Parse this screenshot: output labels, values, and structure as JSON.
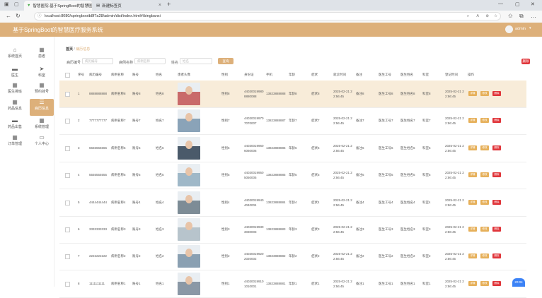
{
  "browser": {
    "tabs": [
      {
        "label": "智慧医院-基于SpringBoot的智慧医疗..."
      },
      {
        "label": "新建标签页"
      }
    ],
    "url": "localhost:8080/springbootb8f7a28/admin/dist/index.html#/bingbanxi"
  },
  "app": {
    "title": "基于SpringBoot的智慧医疗服务系统",
    "user": "admin"
  },
  "sidebar": {
    "items": [
      {
        "label": "系统首页",
        "icon": "home-icon"
      },
      {
        "label": "患者",
        "icon": "grid-icon"
      },
      {
        "label": "医生",
        "icon": "grid-icon"
      },
      {
        "label": "科室",
        "icon": "send-icon"
      },
      {
        "label": "医生排班",
        "icon": "grid-icon"
      },
      {
        "label": "预约挂号",
        "icon": "grid-icon"
      },
      {
        "label": "药品信息",
        "icon": "grid-icon"
      },
      {
        "label": "病历信息",
        "icon": "grid-icon"
      },
      {
        "label": "药品出售",
        "icon": "grid-icon"
      },
      {
        "label": "系统管理",
        "icon": "grid-icon"
      },
      {
        "label": "订单管理",
        "icon": "grid-icon"
      },
      {
        "label": "个人中心",
        "icon": "card-icon"
      }
    ]
  },
  "breadcrumb": {
    "home": "首页",
    "current": "病历信息"
  },
  "search": {
    "field1_label": "病历编号",
    "field1_placeholder": "病历编号",
    "field2_label": "病例名称",
    "field2_placeholder": "病例名称",
    "field3_label": "姓名",
    "field3_placeholder": "姓名",
    "search_btn": "查询",
    "delete_btn": "删除"
  },
  "table": {
    "headers": [
      "序号",
      "病历编号",
      "病例名称",
      "账号",
      "姓名",
      "患者头像",
      "性别",
      "身份证",
      "手机",
      "年龄",
      "症状",
      "就诊时间",
      "备注",
      "医生工号",
      "医生姓名",
      "科室",
      "登记时间",
      "操作"
    ],
    "rows": [
      {
        "idx": "1",
        "no": "8888888888",
        "name": "病例名称8",
        "acct": "账号8",
        "pname": "姓名8",
        "sex": "性别8",
        "id1": "44030019980",
        "id2": "8880088",
        "phone": "13823888888",
        "age": "年龄8",
        "sym": "症状8",
        "t1": "2025-02-21 2",
        "t2": "2:56:45",
        "note": "备注8",
        "dno": "医生工号8",
        "dname": "医生姓名8",
        "dept": "科室8",
        "r1": "2025-02-21 2",
        "r2": "2:56:45"
      },
      {
        "idx": "2",
        "no": "7777777777",
        "name": "病例名称7",
        "acct": "账号7",
        "pname": "姓名7",
        "sex": "性别7",
        "id1": "44030019970",
        "id2": "7070007",
        "phone": "13823888887",
        "age": "年龄7",
        "sym": "症状7",
        "t1": "2025-02-21 2",
        "t2": "2:56:45",
        "note": "备注7",
        "dno": "医生工号7",
        "dname": "医生姓名7",
        "dept": "科室7",
        "r1": "2025-02-21 2",
        "r2": "2:56:45"
      },
      {
        "idx": "3",
        "no": "6666666666",
        "name": "病例名称6",
        "acct": "账号6",
        "pname": "姓名6",
        "sex": "性别6",
        "id1": "44030019960",
        "id2": "6060006",
        "phone": "13823888886",
        "age": "年龄6",
        "sym": "症状6",
        "t1": "2025-02-21 2",
        "t2": "2:56:45",
        "note": "备注6",
        "dno": "医生工号6",
        "dname": "医生姓名6",
        "dept": "科室6",
        "r1": "2025-02-21 2",
        "r2": "2:56:45"
      },
      {
        "idx": "4",
        "no": "5555555555",
        "name": "病例名称5",
        "acct": "账号5",
        "pname": "姓名5",
        "sex": "性别5",
        "id1": "44030019950",
        "id2": "5050005",
        "phone": "13823888885",
        "age": "年龄5",
        "sym": "症状5",
        "t1": "2025-02-21 2",
        "t2": "2:56:45",
        "note": "备注5",
        "dno": "医生工号5",
        "dname": "医生姓名5",
        "dept": "科室5",
        "r1": "2025-02-21 2",
        "r2": "2:56:45"
      },
      {
        "idx": "5",
        "no": "4444444444",
        "name": "病例名称4",
        "acct": "账号4",
        "pname": "姓名4",
        "sex": "性别4",
        "id1": "44030019940",
        "id2": "4040004",
        "phone": "13823888884",
        "age": "年龄4",
        "sym": "症状4",
        "t1": "2025-02-21 2",
        "t2": "2:56:45",
        "note": "备注4",
        "dno": "医生工号4",
        "dname": "医生姓名4",
        "dept": "科室4",
        "r1": "2025-02-21 2",
        "r2": "2:56:45"
      },
      {
        "idx": "6",
        "no": "3333333333",
        "name": "病例名称3",
        "acct": "账号3",
        "pname": "姓名3",
        "sex": "性别3",
        "id1": "44030019930",
        "id2": "3030003",
        "phone": "13823888883",
        "age": "年龄3",
        "sym": "症状3",
        "t1": "2025-02-21 2",
        "t2": "2:56:45",
        "note": "备注3",
        "dno": "医生工号3",
        "dname": "医生姓名3",
        "dept": "科室3",
        "r1": "2025-02-21 2",
        "r2": "2:56:45"
      },
      {
        "idx": "7",
        "no": "2222222222",
        "name": "病例名称2",
        "acct": "账号2",
        "pname": "姓名2",
        "sex": "性别2",
        "id1": "44030019920",
        "id2": "2020002",
        "phone": "13823888882",
        "age": "年龄2",
        "sym": "症状2",
        "t1": "2025-02-21 2",
        "t2": "2:56:45",
        "note": "备注2",
        "dno": "医生工号2",
        "dname": "医生姓名2",
        "dept": "科室2",
        "r1": "2025-02-21 2",
        "r2": "2:56:45"
      },
      {
        "idx": "8",
        "no": "1111111111",
        "name": "病例名称1",
        "acct": "账号1",
        "pname": "姓名1",
        "sex": "性别1",
        "id1": "44030019910",
        "id2": "1010001",
        "phone": "13823888881",
        "age": "年龄1",
        "sym": "症状1",
        "t1": "2025-02-21 2",
        "t2": "2:56:45",
        "note": "备注1",
        "dno": "医生工号1",
        "dname": "医生姓名1",
        "dept": "科室1",
        "r1": "2025-02-21 2",
        "r2": "2:56:45"
      }
    ],
    "action_labels": {
      "view": "详情",
      "edit": "修改",
      "delete": "删除"
    }
  },
  "floating_badge": "20:04",
  "colors": {
    "accent": "#ddb07a",
    "danger": "#e0353a",
    "warning": "#e6b05a"
  }
}
